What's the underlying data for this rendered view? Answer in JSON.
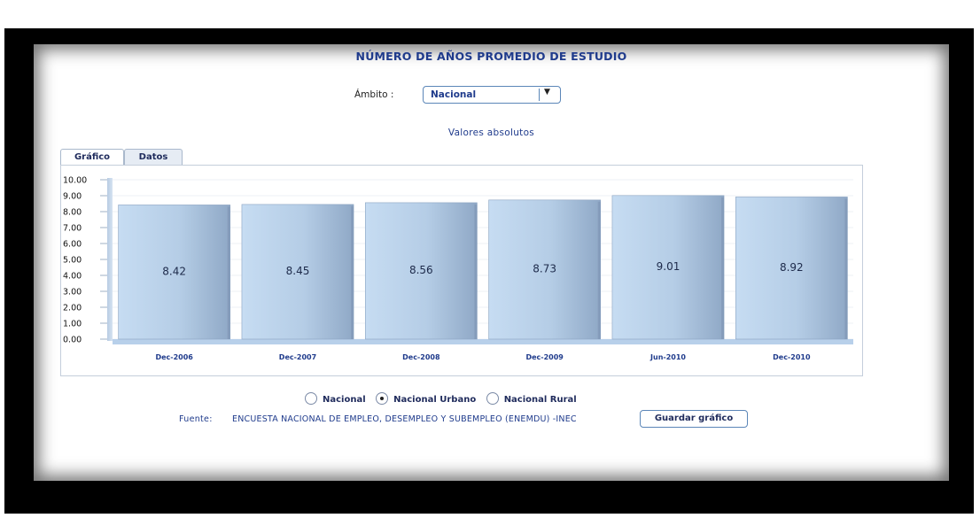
{
  "title": "NÚMERO DE AÑOS PROMEDIO DE ESTUDIO",
  "ambito": {
    "label": "Ámbito :",
    "selected": "Nacional"
  },
  "subtitle": "Valores absolutos",
  "tabs": [
    {
      "label": "Gráfico",
      "active": true
    },
    {
      "label": "Datos",
      "active": false
    }
  ],
  "chart_data": {
    "type": "bar",
    "categories": [
      "Dec-2006",
      "Dec-2007",
      "Dec-2008",
      "Dec-2009",
      "Jun-2010",
      "Dec-2010"
    ],
    "values": [
      8.42,
      8.45,
      8.56,
      8.73,
      9.01,
      8.92
    ],
    "value_labels": [
      "8.42",
      "8.45",
      "8.56",
      "8.73",
      "9.01",
      "8.92"
    ],
    "ylim": [
      0,
      10
    ],
    "yticks": [
      "0.00",
      "1.00",
      "2.00",
      "3.00",
      "4.00",
      "5.00",
      "6.00",
      "7.00",
      "8.00",
      "9.00",
      "10.00"
    ],
    "grid": true,
    "bar_color": "#b8d2ec"
  },
  "radio_options": [
    {
      "label": "Nacional",
      "selected": false
    },
    {
      "label": "Nacional Urbano",
      "selected": true
    },
    {
      "label": "Nacional Rural",
      "selected": false
    }
  ],
  "fuente": {
    "label": "Fuente:",
    "text": "ENCUESTA NACIONAL DE EMPLEO, DESEMPLEO Y SUBEMPLEO (ENEMDU) -INEC"
  },
  "save_button": "Guardar gráfico"
}
